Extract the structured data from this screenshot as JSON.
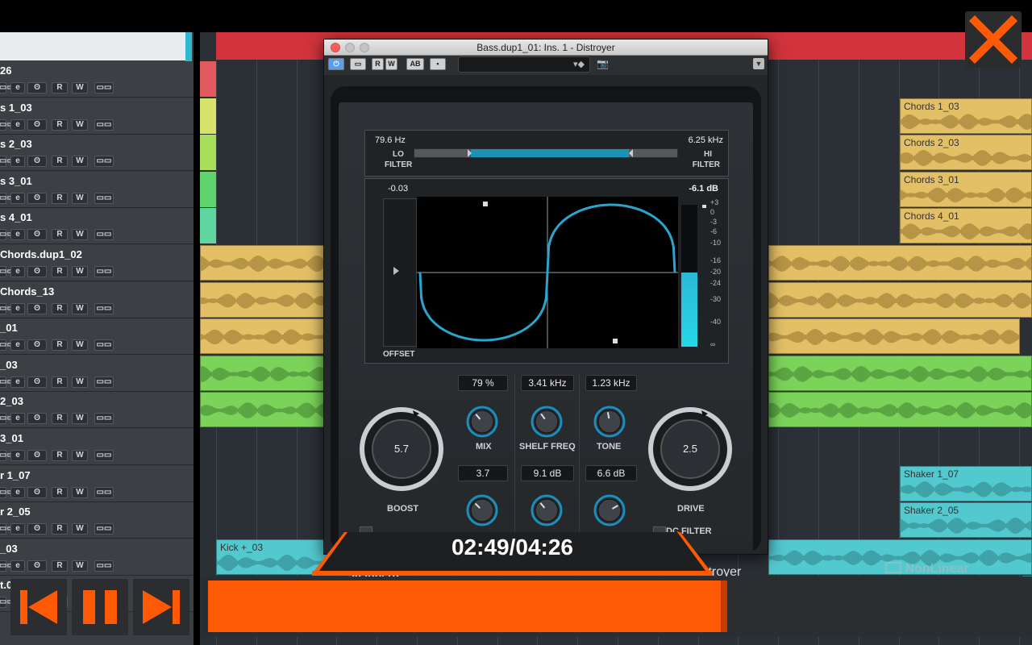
{
  "tracks": [
    {
      "name": "26",
      "strip": "#e25a60"
    },
    {
      "name": "s 1_03",
      "strip": "#d7e36a"
    },
    {
      "name": "s 2_03",
      "strip": "#a8df5a"
    },
    {
      "name": "s 3_01",
      "strip": "#5fd46c"
    },
    {
      "name": "s 4_01",
      "strip": "#5fd6a0"
    },
    {
      "name": "Chords.dup1_02",
      "strip": ""
    },
    {
      "name": "Chords_13",
      "strip": ""
    },
    {
      "name": "_01",
      "strip": ""
    },
    {
      "name": "_03",
      "strip": ""
    },
    {
      "name": "2_03",
      "strip": ""
    },
    {
      "name": "3_01",
      "strip": ""
    },
    {
      "name": "r 1_07",
      "strip": ""
    },
    {
      "name": "r 2_05",
      "strip": ""
    },
    {
      "name": "_03",
      "strip": ""
    },
    {
      "name": "t.0",
      "strip": ""
    }
  ],
  "track_buttons": {
    "e": "e",
    "link": "ʘ",
    "r": "R",
    "w": "W",
    "lane": "▭▭"
  },
  "clips": [
    {
      "name": "Chords 1_03",
      "color": "yellow"
    },
    {
      "name": "Chords 2_03",
      "color": "yellow"
    },
    {
      "name": "Chords 3_01",
      "color": "yellow"
    },
    {
      "name": "Chords 4_01",
      "color": "yellow"
    },
    {
      "name": "Shaker 1_07",
      "color": "cyan"
    },
    {
      "name": "Shaker 2_05",
      "color": "cyan"
    },
    {
      "name": "Kick +_03",
      "color": "cyan"
    }
  ],
  "plugin": {
    "title": "Bass.dup1_01: Ins. 1 - Distroyer",
    "toolbar": {
      "rw_r": "R",
      "rw_w": "W",
      "ab": "AB"
    },
    "filter": {
      "lo_value": "79.6 Hz",
      "hi_value": "6.25 kHz",
      "lo_label": "LO\nFILTER",
      "hi_label": "HI\nFILTER",
      "lo_label_1": "LO",
      "lo_label_2": "FILTER",
      "hi_label_1": "HI",
      "hi_label_2": "FILTER"
    },
    "curve": {
      "offset_value": "-0.03",
      "offset_label": "OFFSET",
      "output_db": "-6.1 dB",
      "meter_level": 0.52
    },
    "meter_scale": [
      "+3",
      "0",
      "-3",
      "-6",
      "-10",
      "-16",
      "-20",
      "-24",
      "-30",
      "-40",
      "∞"
    ],
    "knobs": {
      "mix": {
        "value": "79 %",
        "label": "MIX"
      },
      "shelf_freq": {
        "value": "3.41 kHz",
        "label": "SHELF FREQ"
      },
      "tone": {
        "value": "1.23 kHz",
        "label": "TONE"
      },
      "knob_a": {
        "value": "3.7"
      },
      "knob_b": {
        "value": "9.1 dB"
      },
      "knob_c": {
        "value": "6.6 dB"
      },
      "boost": {
        "value": "5.7",
        "label": "BOOST"
      },
      "drive": {
        "value": "2.5",
        "label": "DRIVE"
      }
    },
    "dc_filter_label": "DC FILTER",
    "brand_left": "steinberg",
    "brand_right": "distroyer"
  },
  "player": {
    "time": "02:49/04:26",
    "progress": 0.63,
    "accent": "#fe5a06"
  },
  "watermark": "NonLinear"
}
